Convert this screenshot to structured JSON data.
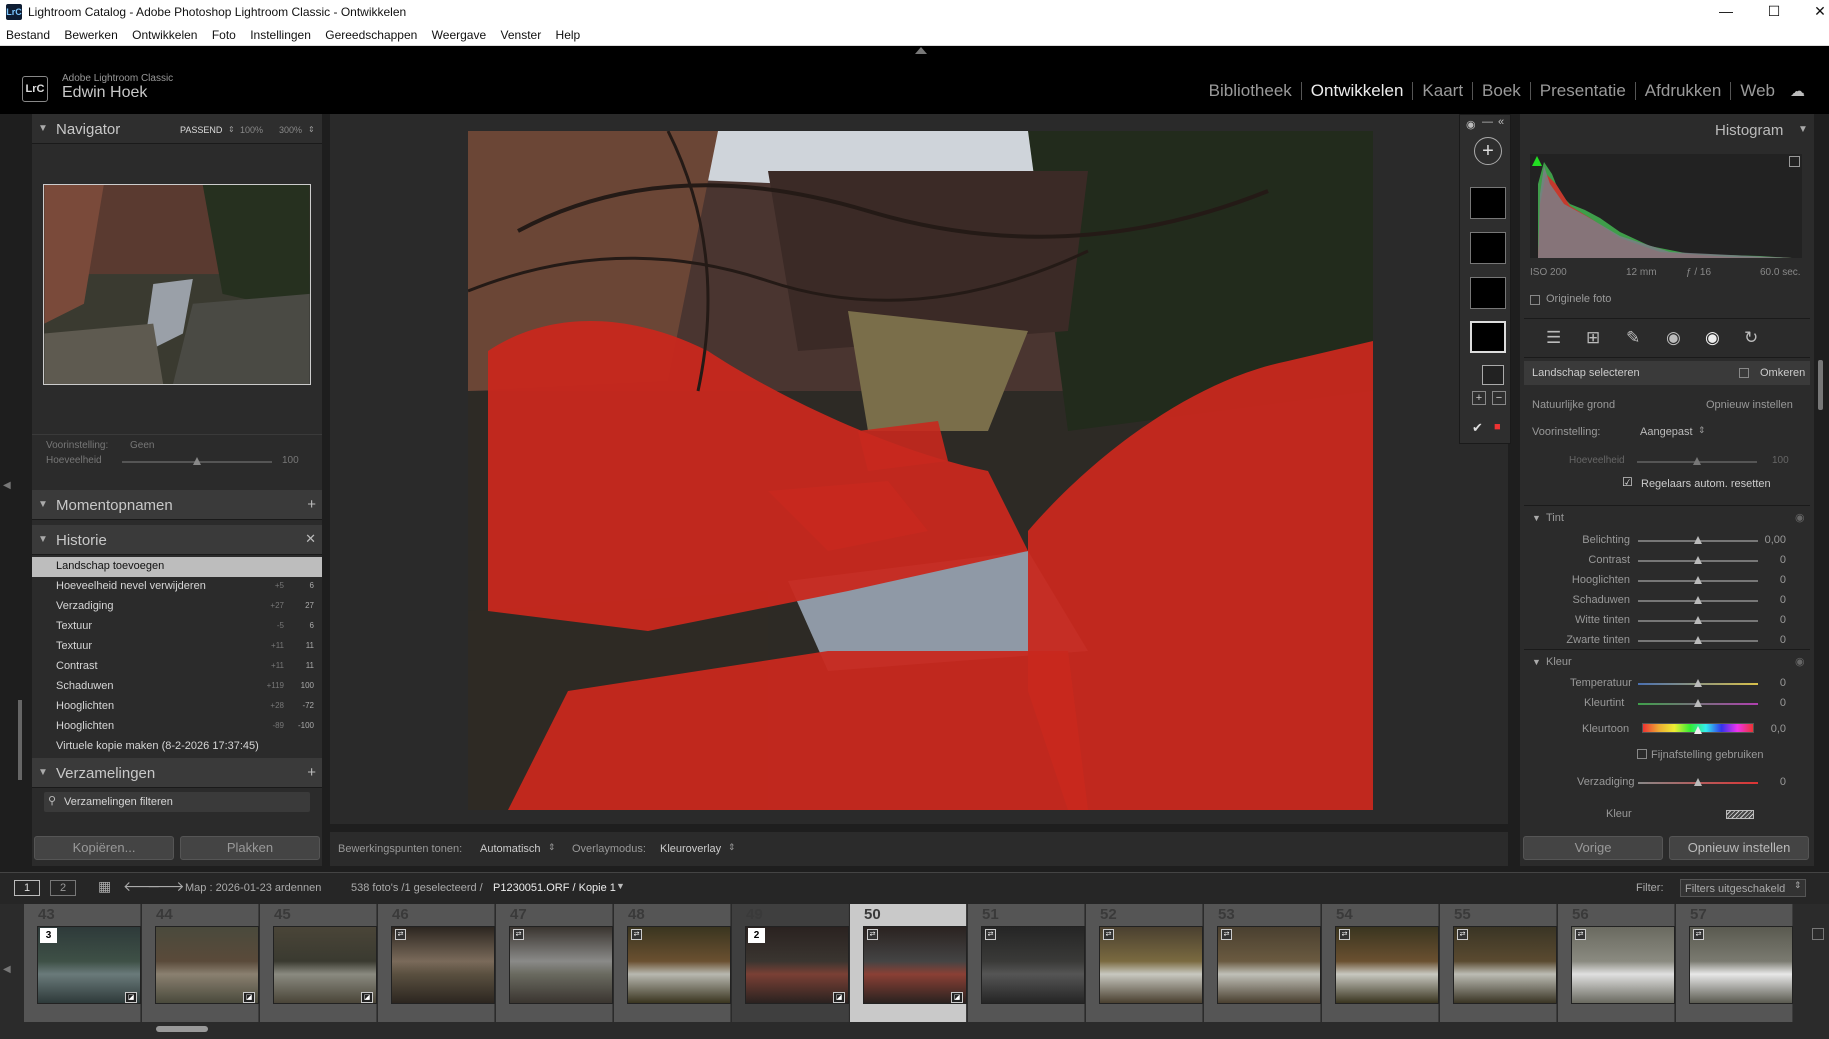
{
  "window": {
    "title": "Lightroom Catalog - Adobe Photoshop Lightroom Classic - Ontwikkelen",
    "app_icon": "LrC"
  },
  "menu": [
    "Bestand",
    "Bewerken",
    "Ontwikkelen",
    "Foto",
    "Instellingen",
    "Gereedschappen",
    "Weergave",
    "Venster",
    "Help"
  ],
  "identity": {
    "logo": "LrC",
    "product": "Adobe Lightroom Classic",
    "user": "Edwin Hoek"
  },
  "modules": [
    "Bibliotheek",
    "Ontwikkelen",
    "Kaart",
    "Boek",
    "Presentatie",
    "Afdrukken",
    "Web"
  ],
  "active_module": "Ontwikkelen",
  "navigator": {
    "title": "Navigator",
    "zoom_fit": "PASSEND",
    "zoom_100": "100%",
    "zoom_300": "300%"
  },
  "preset_box": {
    "label": "Voorinstelling:",
    "value": "Geen",
    "amount_label": "Hoeveelheid",
    "amount_value": "100",
    "amount_fraction": 0.5
  },
  "snapshots": {
    "title": "Momentopnamen",
    "add": "+"
  },
  "history": {
    "title": "Historie",
    "close": "✕",
    "items": [
      {
        "label": "Landschap toevoegen",
        "v1": "",
        "v2": ""
      },
      {
        "label": "Hoeveelheid nevel verwijderen",
        "v1": "+5",
        "v2": "6"
      },
      {
        "label": "Verzadiging",
        "v1": "+27",
        "v2": "27"
      },
      {
        "label": "Textuur",
        "v1": "-5",
        "v2": "6"
      },
      {
        "label": "Textuur",
        "v1": "+11",
        "v2": "11"
      },
      {
        "label": "Contrast",
        "v1": "+11",
        "v2": "11"
      },
      {
        "label": "Schaduwen",
        "v1": "+119",
        "v2": "100"
      },
      {
        "label": "Hooglichten",
        "v1": "+28",
        "v2": "-72"
      },
      {
        "label": "Hooglichten",
        "v1": "-89",
        "v2": "-100"
      },
      {
        "label": "Virtuele kopie maken (8-2-2026 17:37:45)",
        "v1": "",
        "v2": ""
      }
    ]
  },
  "collections": {
    "title": "Verzamelingen",
    "add": "+",
    "filter_placeholder": "Verzamelingen filteren"
  },
  "left_buttons": {
    "copy": "Kopiëren...",
    "paste": "Plakken"
  },
  "bottom_toolbar": {
    "pins_label": "Bewerkingspunten tonen:",
    "pins_value": "Automatisch",
    "overlay_label": "Overlaymodus:",
    "overlay_value": "Kleuroverlay"
  },
  "histogram": {
    "title": "Histogram",
    "iso": "ISO 200",
    "focal": "12 mm",
    "aperture": "ƒ / 16",
    "shutter": "60.0 sec.",
    "original_label": "Originele foto"
  },
  "mask_panel": {
    "title": "Landschap selecteren",
    "invert_label": "Omkeren",
    "subtype": "Natuurlijke grond",
    "reset_label": "Opnieuw instellen",
    "preset_label": "Voorinstelling:",
    "preset_value": "Aangepast",
    "amount_label": "Hoeveelheid",
    "amount_value": "100",
    "autoreset_label": "Regelaars autom. resetten"
  },
  "tone": {
    "title": "Tint",
    "sliders": [
      {
        "label": "Belichting",
        "value": "0,00"
      },
      {
        "label": "Contrast",
        "value": "0"
      },
      {
        "label": "Hooglichten",
        "value": "0"
      },
      {
        "label": "Schaduwen",
        "value": "0"
      },
      {
        "label": "Witte tinten",
        "value": "0"
      },
      {
        "label": "Zwarte tinten",
        "value": "0"
      }
    ]
  },
  "color": {
    "title": "Kleur",
    "temp_label": "Temperatuur",
    "temp_value": "0",
    "tint_label": "Kleurtint",
    "tint_value": "0",
    "hue_label": "Kleurtoon",
    "hue_value": "0,0",
    "fine_label": "Fijnafstelling gebruiken",
    "sat_label": "Verzadiging",
    "sat_value": "0",
    "color_label": "Kleur"
  },
  "right_buttons": {
    "prev": "Vorige",
    "reset": "Opnieuw instellen"
  },
  "filmstrip_bar": {
    "view1": "1",
    "view2": "2",
    "path": "Map : 2026-01-23 ardennen",
    "count": "538 foto's /1 geselecteerd /",
    "file": "P1230051.ORF / Kopie 1",
    "filter_label": "Filter:",
    "filter_value": "Filters uitgeschakeld"
  },
  "filmstrip": [
    {
      "num": "43",
      "kind": "light",
      "badge": "3"
    },
    {
      "num": "44",
      "kind": "light",
      "badge": ""
    },
    {
      "num": "45",
      "kind": "light",
      "badge": ""
    },
    {
      "num": "46",
      "kind": "light",
      "badge": ""
    },
    {
      "num": "47",
      "kind": "light",
      "badge": ""
    },
    {
      "num": "48",
      "kind": "light",
      "badge": ""
    },
    {
      "num": "49",
      "kind": "dark",
      "badge": "2"
    },
    {
      "num": "50",
      "kind": "sel",
      "badge": ""
    },
    {
      "num": "51",
      "kind": "light",
      "badge": ""
    },
    {
      "num": "52",
      "kind": "light",
      "badge": ""
    },
    {
      "num": "53",
      "kind": "light",
      "badge": ""
    },
    {
      "num": "54",
      "kind": "light",
      "badge": ""
    },
    {
      "num": "55",
      "kind": "light",
      "badge": ""
    },
    {
      "num": "56",
      "kind": "light",
      "badge": ""
    },
    {
      "num": "57",
      "kind": "light",
      "badge": ""
    }
  ]
}
